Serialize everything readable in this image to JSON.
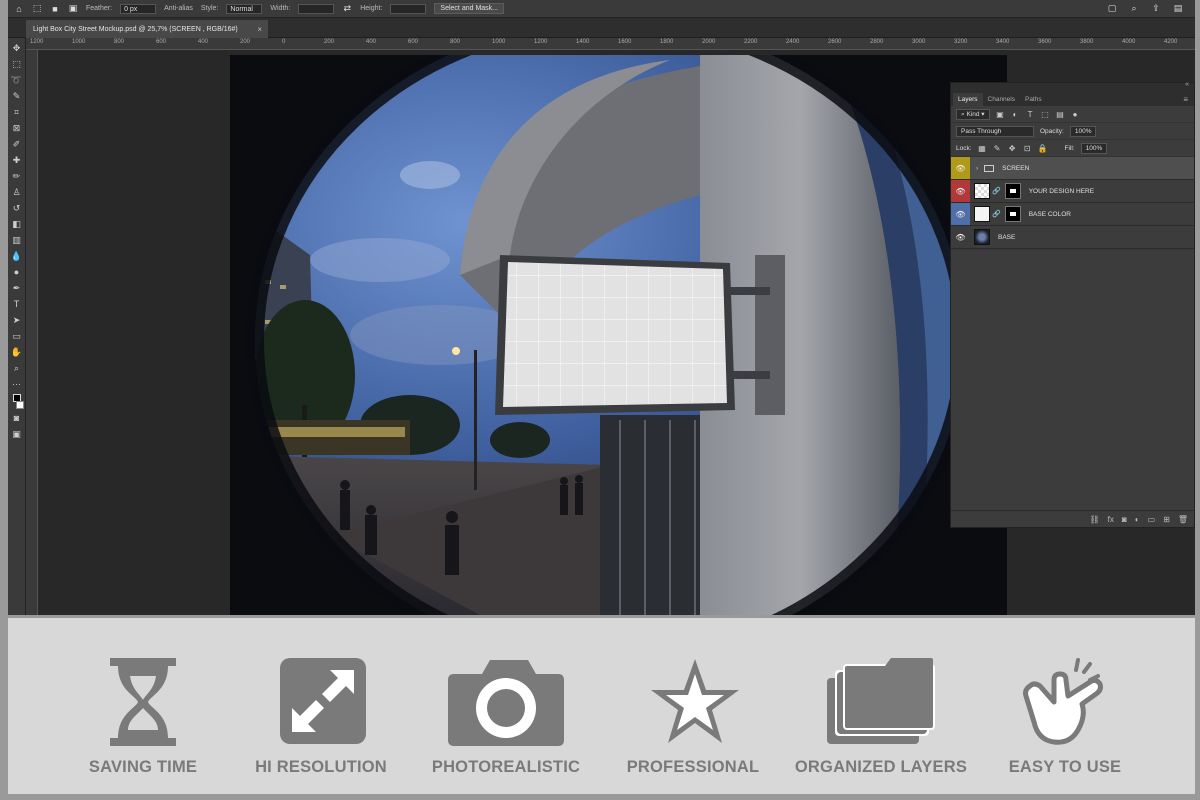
{
  "options_bar": {
    "feather_label": "Feather:",
    "feather_value": "0 px",
    "anti_alias_label": "Anti-alias",
    "style_label": "Style:",
    "style_value": "Normal",
    "width_label": "Width:",
    "height_label": "Height:",
    "select_mask_label": "Select and Mask..."
  },
  "document_tab": {
    "title": "Light Box City Street Mockup.psd @ 25,7% (SCREEN , RGB/16#)",
    "close": "×"
  },
  "ruler": {
    "top_ticks": [
      "1200",
      "1000",
      "800",
      "600",
      "400",
      "200",
      "0",
      "200",
      "400",
      "600",
      "800",
      "1000",
      "1200",
      "1400",
      "1600",
      "1800",
      "2000",
      "2200",
      "2400",
      "2600",
      "2800",
      "3000",
      "3200",
      "3400",
      "3600",
      "3800",
      "4000",
      "4200"
    ]
  },
  "layers_panel": {
    "tabs": [
      "Layers",
      "Channels",
      "Paths"
    ],
    "kind_label": "Kind",
    "blend_mode": "Pass Through",
    "opacity_label": "Opacity:",
    "opacity_value": "100%",
    "lock_label": "Lock:",
    "fill_label": "Fill:",
    "fill_value": "100%",
    "layers": [
      {
        "name": "SCREEN",
        "eye_color": "#b09a17"
      },
      {
        "name": "YOUR DESIGN HERE",
        "eye_color": "#b03a3a"
      },
      {
        "name": "BASE COLOR",
        "eye_color": "#4f6fa8"
      },
      {
        "name": "BASE",
        "eye_color": ""
      }
    ]
  },
  "features": [
    {
      "label": "SAVING TIME",
      "icon": "hourglass-icon"
    },
    {
      "label": "HI RESOLUTION",
      "icon": "expand-arrows-icon"
    },
    {
      "label": "PHOTOREALISTIC",
      "icon": "camera-icon"
    },
    {
      "label": "PROFESSIONAL",
      "icon": "star-icon"
    },
    {
      "label": "ORGANIZED LAYERS",
      "icon": "stacked-folders-icon"
    },
    {
      "label": "EASY TO USE",
      "icon": "finger-snap-icon"
    }
  ],
  "colors": {
    "app_background": "#282828",
    "panel": "#3c3c3c",
    "strip": "#d8d8d8",
    "feature_gray": "#7a7a7a"
  }
}
